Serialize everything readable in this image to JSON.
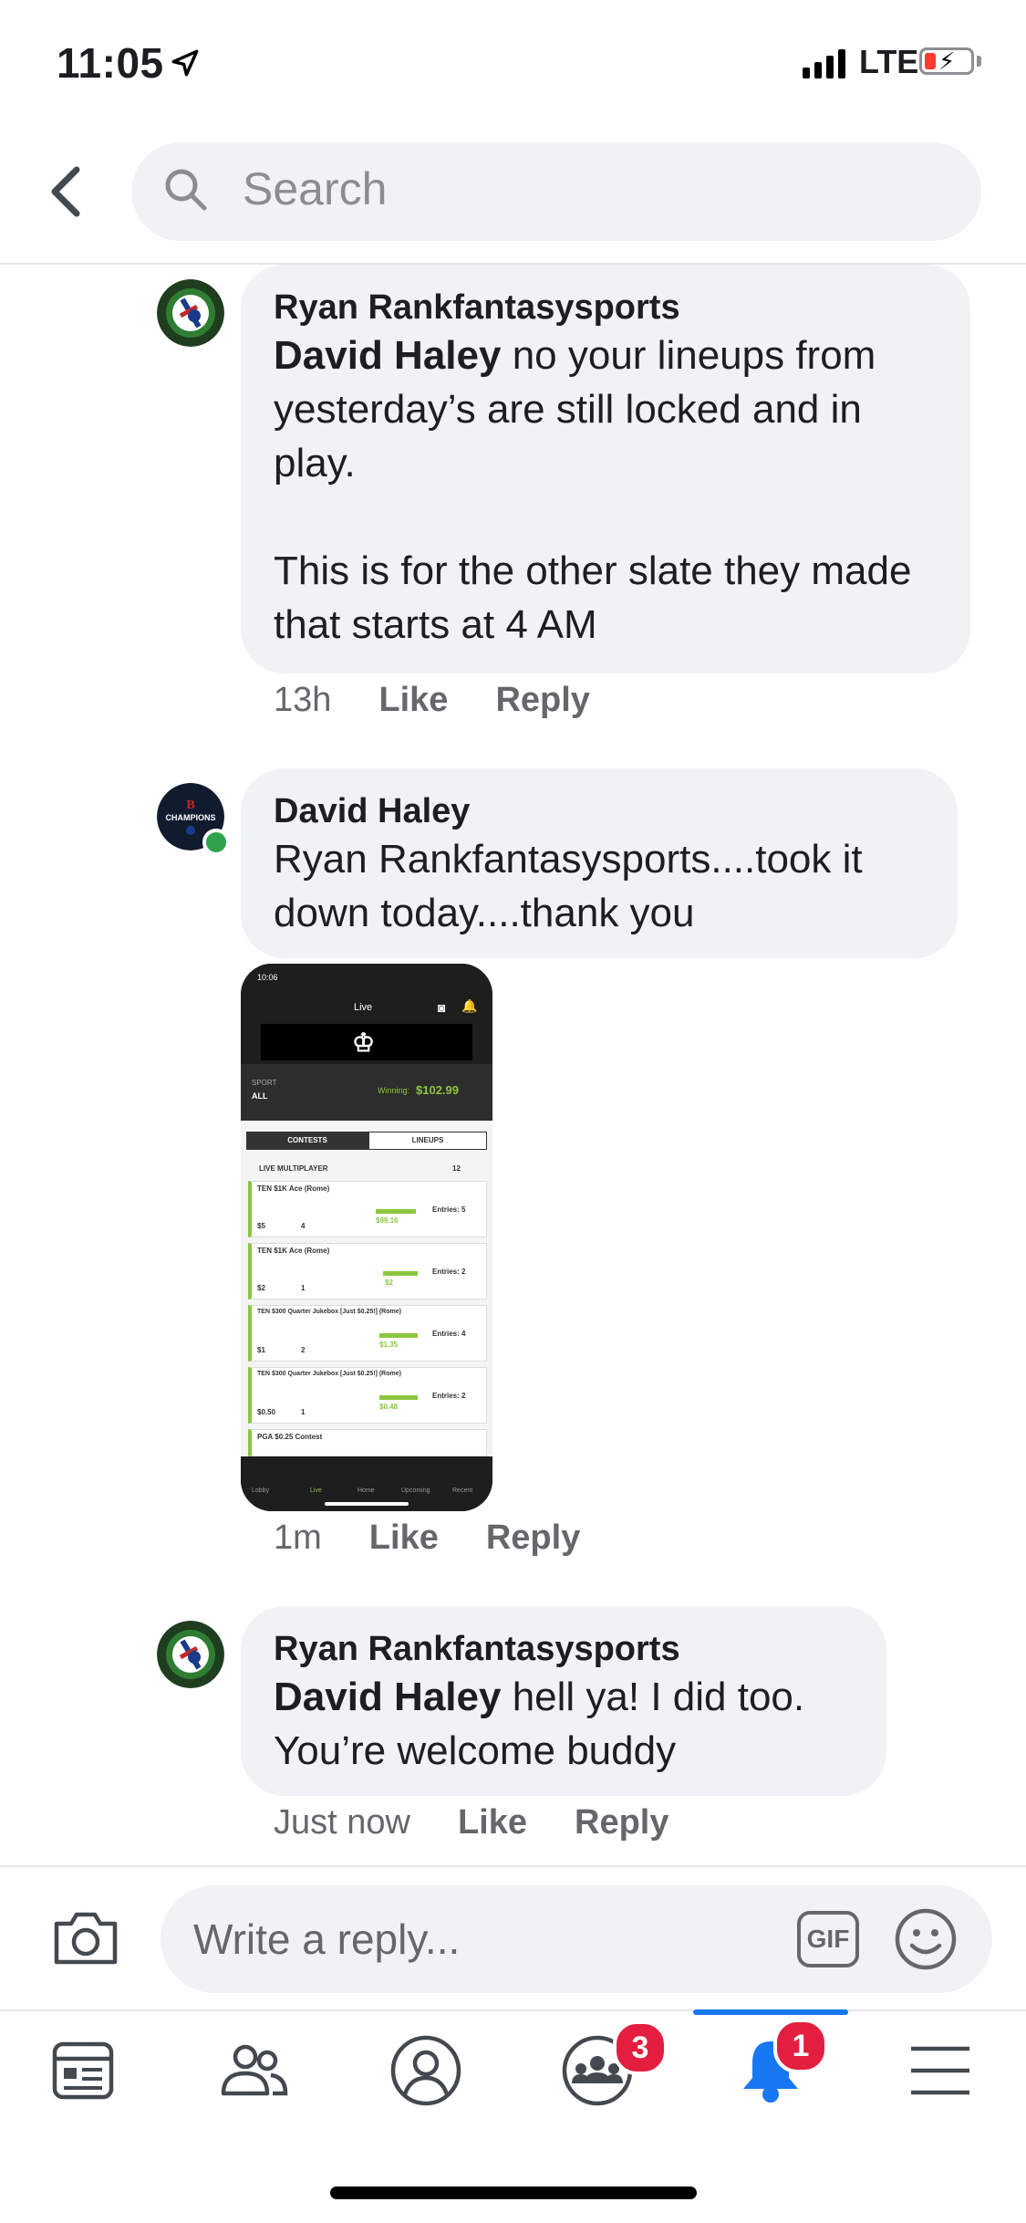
{
  "status_bar": {
    "time": "11:05",
    "network": "LTE"
  },
  "header": {
    "search_placeholder": "Search"
  },
  "comments": [
    {
      "author": "Ryan Rankfantasysports",
      "mention": "David Haley",
      "text": " no your lineups from yesterday’s are still locked and in play.\n\nThis is for the other slate they made that starts at 4 AM",
      "time": "13h",
      "like_label": "Like",
      "reply_label": "Reply"
    },
    {
      "author": "David Haley",
      "text": "Ryan Rankfantasysports....took it down today....thank you",
      "time": "1m",
      "like_label": "Like",
      "reply_label": "Reply",
      "attachment": {
        "status_time": "10:06",
        "title": "Live",
        "sport_label": "SPORT",
        "sport_value": "ALL",
        "winning_label": "Winning:",
        "winning_value": "$102.99",
        "tab_contests": "CONTESTS",
        "tab_lineups": "LINEUPS",
        "section": "LIVE MULTIPLAYER",
        "section_count": "12",
        "contests": [
          {
            "name": "TEN $1K Ace (Rome)",
            "entry": "$5",
            "placing": "4",
            "won": "$99.16",
            "entries": "Entries: 5"
          },
          {
            "name": "TEN $1K Ace (Rome)",
            "entry": "$2",
            "placing": "1",
            "won": "$2",
            "entries": "Entries: 2"
          },
          {
            "name": "TEN $300 Quarter Jukebox [Just $0.25!] (Rome)",
            "entry": "$1",
            "placing": "2",
            "won": "$1.35",
            "entries": "Entries: 4"
          },
          {
            "name": "TEN $300 Quarter Jukebox [Just $0.25!] (Rome)",
            "entry": "$0.50",
            "placing": "1",
            "won": "$0.48",
            "entries": "Entries: 2"
          }
        ],
        "last_row": "PGA $0.25 Contest",
        "nav": [
          "Lobby",
          "Live",
          "Home",
          "Upcoming",
          "Recent"
        ]
      }
    },
    {
      "author": "Ryan Rankfantasysports",
      "mention": "David Haley",
      "text": " hell ya! I did too. You’re welcome buddy",
      "time": "Just now",
      "like_label": "Like",
      "reply_label": "Reply"
    }
  ],
  "composer": {
    "placeholder": "Write a reply...",
    "gif_label": "GIF"
  },
  "tabbar": {
    "items": [
      {
        "icon": "news-feed-icon"
      },
      {
        "icon": "friends-icon"
      },
      {
        "icon": "profile-icon"
      },
      {
        "icon": "groups-icon",
        "badge": "3"
      },
      {
        "icon": "notifications-bell-icon",
        "badge": "1",
        "active": true
      },
      {
        "icon": "menu-icon"
      }
    ]
  },
  "colors": {
    "accent": "#1877f2",
    "badge": "#e41e3f",
    "bubble": "#f0f2f5",
    "online": "#31a24c",
    "dk_green": "#8cc63f"
  }
}
